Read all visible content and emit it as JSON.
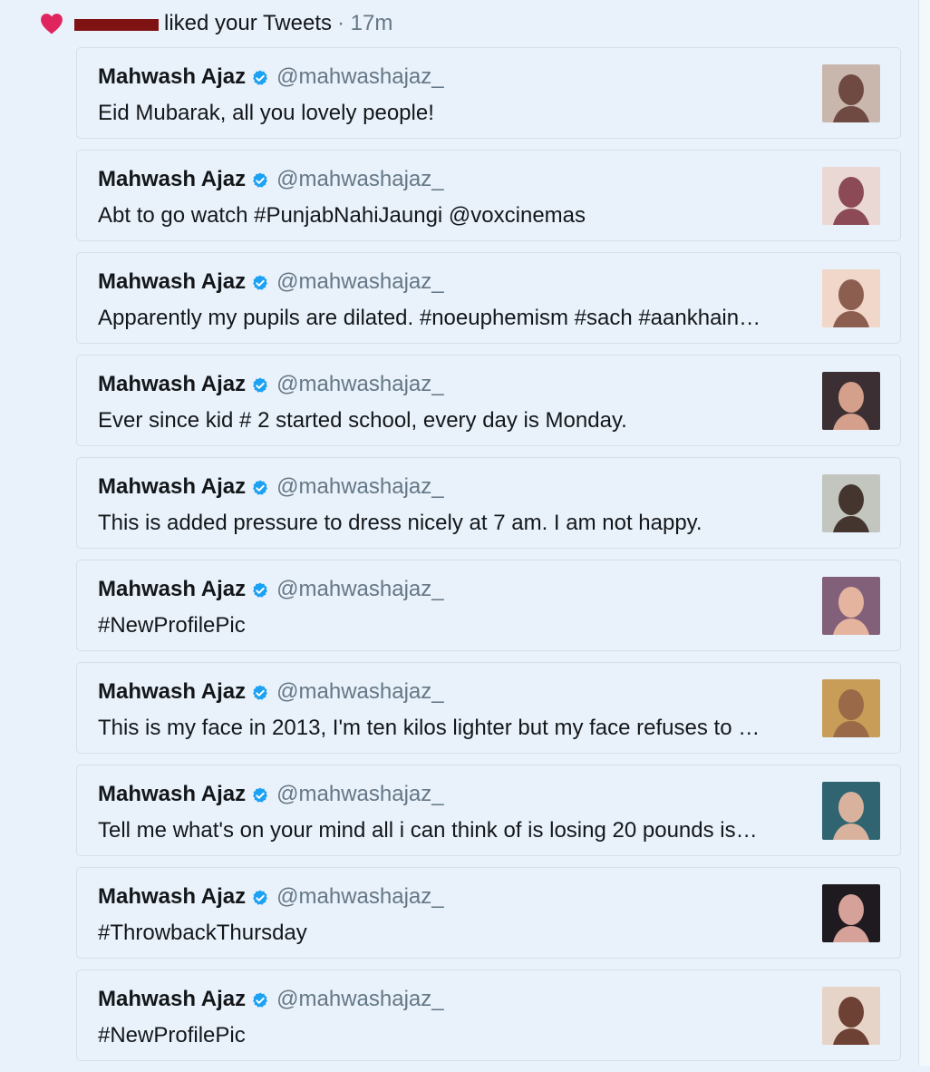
{
  "notification": {
    "icon": "heart-icon",
    "action": "liked your Tweets",
    "time": "· 17m"
  },
  "tweets": [
    {
      "name": "Mahwash Ajaz",
      "handle": "@mahwashajaz_",
      "text": "Eid Mubarak, all you lovely people!",
      "thumb_bg": "#c9b7ad",
      "thumb_fg": "#6e4a42"
    },
    {
      "name": "Mahwash Ajaz",
      "handle": "@mahwashajaz_",
      "text": "Abt to go watch #PunjabNahiJaungi @voxcinemas",
      "thumb_bg": "#ead8d5",
      "thumb_fg": "#8b4a56"
    },
    {
      "name": "Mahwash Ajaz",
      "handle": "@mahwashajaz_",
      "text": "Apparently my pupils are dilated. #noeuphemism #sach #aankhain…",
      "thumb_bg": "#f1d7c9",
      "thumb_fg": "#8c5e50"
    },
    {
      "name": "Mahwash Ajaz",
      "handle": "@mahwashajaz_",
      "text": "Ever since kid # 2 started school, every day is Monday.",
      "thumb_bg": "#3c2f33",
      "thumb_fg": "#d4a08b"
    },
    {
      "name": "Mahwash Ajaz",
      "handle": "@mahwashajaz_",
      "text": "This is added pressure to dress nicely at 7 am. I am not happy.",
      "thumb_bg": "#c3c6bf",
      "thumb_fg": "#44352f"
    },
    {
      "name": "Mahwash Ajaz",
      "handle": "@mahwashajaz_",
      "text": "#NewProfilePic",
      "thumb_bg": "#82607a",
      "thumb_fg": "#e4b49f"
    },
    {
      "name": "Mahwash Ajaz",
      "handle": "@mahwashajaz_",
      "text": "This is my face in 2013, I'm ten kilos lighter but my face refuses to …",
      "thumb_bg": "#c89d58",
      "thumb_fg": "#9a6947"
    },
    {
      "name": "Mahwash Ajaz",
      "handle": "@mahwashajaz_",
      "text": "Tell me what's on your mind all i can think of is losing 20 pounds is…",
      "thumb_bg": "#2f6470",
      "thumb_fg": "#d9b29d"
    },
    {
      "name": "Mahwash Ajaz",
      "handle": "@mahwashajaz_",
      "text": "#ThrowbackThursday",
      "thumb_bg": "#1f1a1f",
      "thumb_fg": "#d5a198"
    },
    {
      "name": "Mahwash Ajaz",
      "handle": "@mahwashajaz_",
      "text": "#NewProfilePic",
      "thumb_bg": "#e7d4c9",
      "thumb_fg": "#6d4133"
    }
  ],
  "colors": {
    "background": "#e9f2fb",
    "heart": "#e0245e",
    "verified": "#1da1f2",
    "handle": "#657786",
    "redaction": "#7f1313"
  }
}
